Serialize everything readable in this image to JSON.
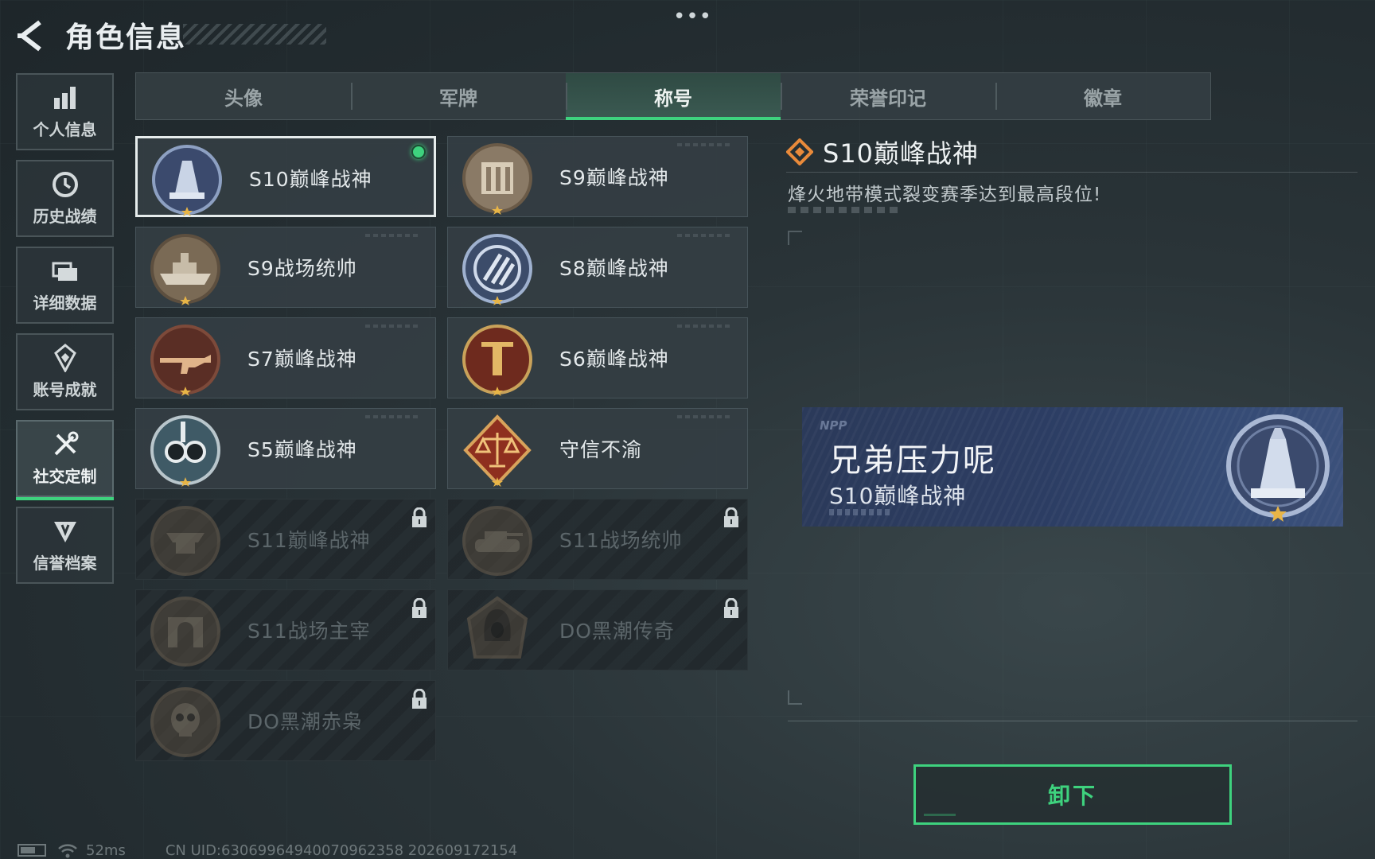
{
  "header": {
    "title": "角色信息",
    "more_label": "•••"
  },
  "sidebar": {
    "items": [
      {
        "label": "个人信息",
        "icon": "bar-chart-icon",
        "active": false
      },
      {
        "label": "历史战绩",
        "icon": "clock-icon",
        "active": false
      },
      {
        "label": "详细数据",
        "icon": "folder-icon",
        "active": false
      },
      {
        "label": "账号成就",
        "icon": "achievement-icon",
        "active": false
      },
      {
        "label": "社交定制",
        "icon": "tools-icon",
        "active": true
      },
      {
        "label": "信誉档案",
        "icon": "shield-icon",
        "active": false
      }
    ]
  },
  "tabs": [
    {
      "label": "头像",
      "active": false
    },
    {
      "label": "军牌",
      "active": false
    },
    {
      "label": "称号",
      "active": true
    },
    {
      "label": "荣誉印记",
      "active": false
    },
    {
      "label": "徽章",
      "active": false
    }
  ],
  "titles": [
    {
      "name": "S10巅峰战神",
      "locked": false,
      "selected": true,
      "equipped": true,
      "medal": "peak-god-s10-medal-icon"
    },
    {
      "name": "S9巅峰战神",
      "locked": false,
      "selected": false,
      "equipped": false,
      "medal": "peak-god-s9-medal-icon"
    },
    {
      "name": "S9战场统帅",
      "locked": false,
      "selected": false,
      "equipped": false,
      "medal": "battleship-medal-icon"
    },
    {
      "name": "S8巅峰战神",
      "locked": false,
      "selected": false,
      "equipped": false,
      "medal": "stripes-medal-icon"
    },
    {
      "name": "S7巅峰战神",
      "locked": false,
      "selected": false,
      "equipped": false,
      "medal": "rifle-medal-icon"
    },
    {
      "name": "S6巅峰战神",
      "locked": false,
      "selected": false,
      "equipped": false,
      "medal": "crest-medal-icon"
    },
    {
      "name": "S5巅峰战神",
      "locked": false,
      "selected": false,
      "equipped": false,
      "medal": "diver-mask-medal-icon"
    },
    {
      "name": "守信不渝",
      "locked": false,
      "selected": false,
      "equipped": false,
      "medal": "scales-medal-icon"
    },
    {
      "name": "S11巅峰战神",
      "locked": true,
      "selected": false,
      "equipped": false,
      "medal": "anvil-medal-icon"
    },
    {
      "name": "S11战场统帅",
      "locked": true,
      "selected": false,
      "equipped": false,
      "medal": "tank-medal-icon"
    },
    {
      "name": "S11战场主宰",
      "locked": true,
      "selected": false,
      "equipped": false,
      "medal": "arch-medal-icon"
    },
    {
      "name": "DO黑潮传奇",
      "locked": true,
      "selected": false,
      "equipped": false,
      "medal": "hooded-figure-medal-icon"
    },
    {
      "name": "DO黑潮赤枭",
      "locked": true,
      "selected": false,
      "equipped": false,
      "medal": "skull-medal-icon"
    }
  ],
  "detail": {
    "title": "S10巅峰战神",
    "description": "烽火地带模式裂变赛季达到最高段位!"
  },
  "preview": {
    "tag": "NPP",
    "player_name": "兄弟压力呢",
    "title": "S10巅峰战神"
  },
  "actions": {
    "unequip_label": "卸下"
  },
  "footer": {
    "ping": "52ms",
    "uid": "CN UID:63069964940070962358 202609172154"
  },
  "colors": {
    "accent": "#3ed27e",
    "panel": "#343e43",
    "locked_text": "#5c666a",
    "preview_bg": "#2c3d63"
  }
}
